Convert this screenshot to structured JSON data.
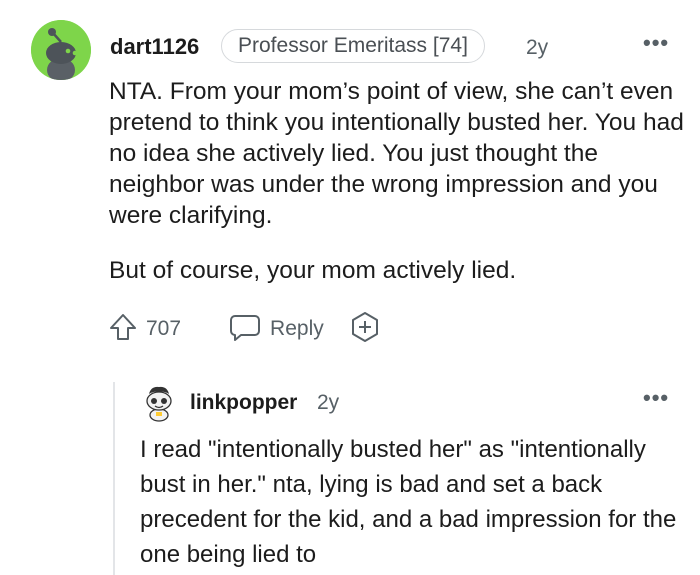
{
  "comment": {
    "author": "dart1126",
    "flair": "Professor Emeritass [74]",
    "age": "2y",
    "more": "•••",
    "paragraphs": [
      "NTA. From your mom’s point of view, she can’t even pretend to think you intentionally busted her. You had no idea she actively lied. You just thought the neighbor was under the wrong impression and you were clarifying.",
      "But of course, your mom actively lied."
    ],
    "votes": "707",
    "reply_label": "Reply",
    "icons": [
      "upvote-icon",
      "reply-icon",
      "award-plus-icon",
      "more-icon"
    ]
  },
  "reply": {
    "author": "linkpopper",
    "age": "2y",
    "more": "•••",
    "text": "I read \"intentionally busted her\" as \"intentionally bust in her.\" nta, lying is bad and set a back precedent for the kid, and a bad impression for the one being lied to"
  },
  "colors": {
    "avatar_bg": "#7ed54a",
    "meta_text": "#576066",
    "thread_line": "#e3e5e8"
  }
}
